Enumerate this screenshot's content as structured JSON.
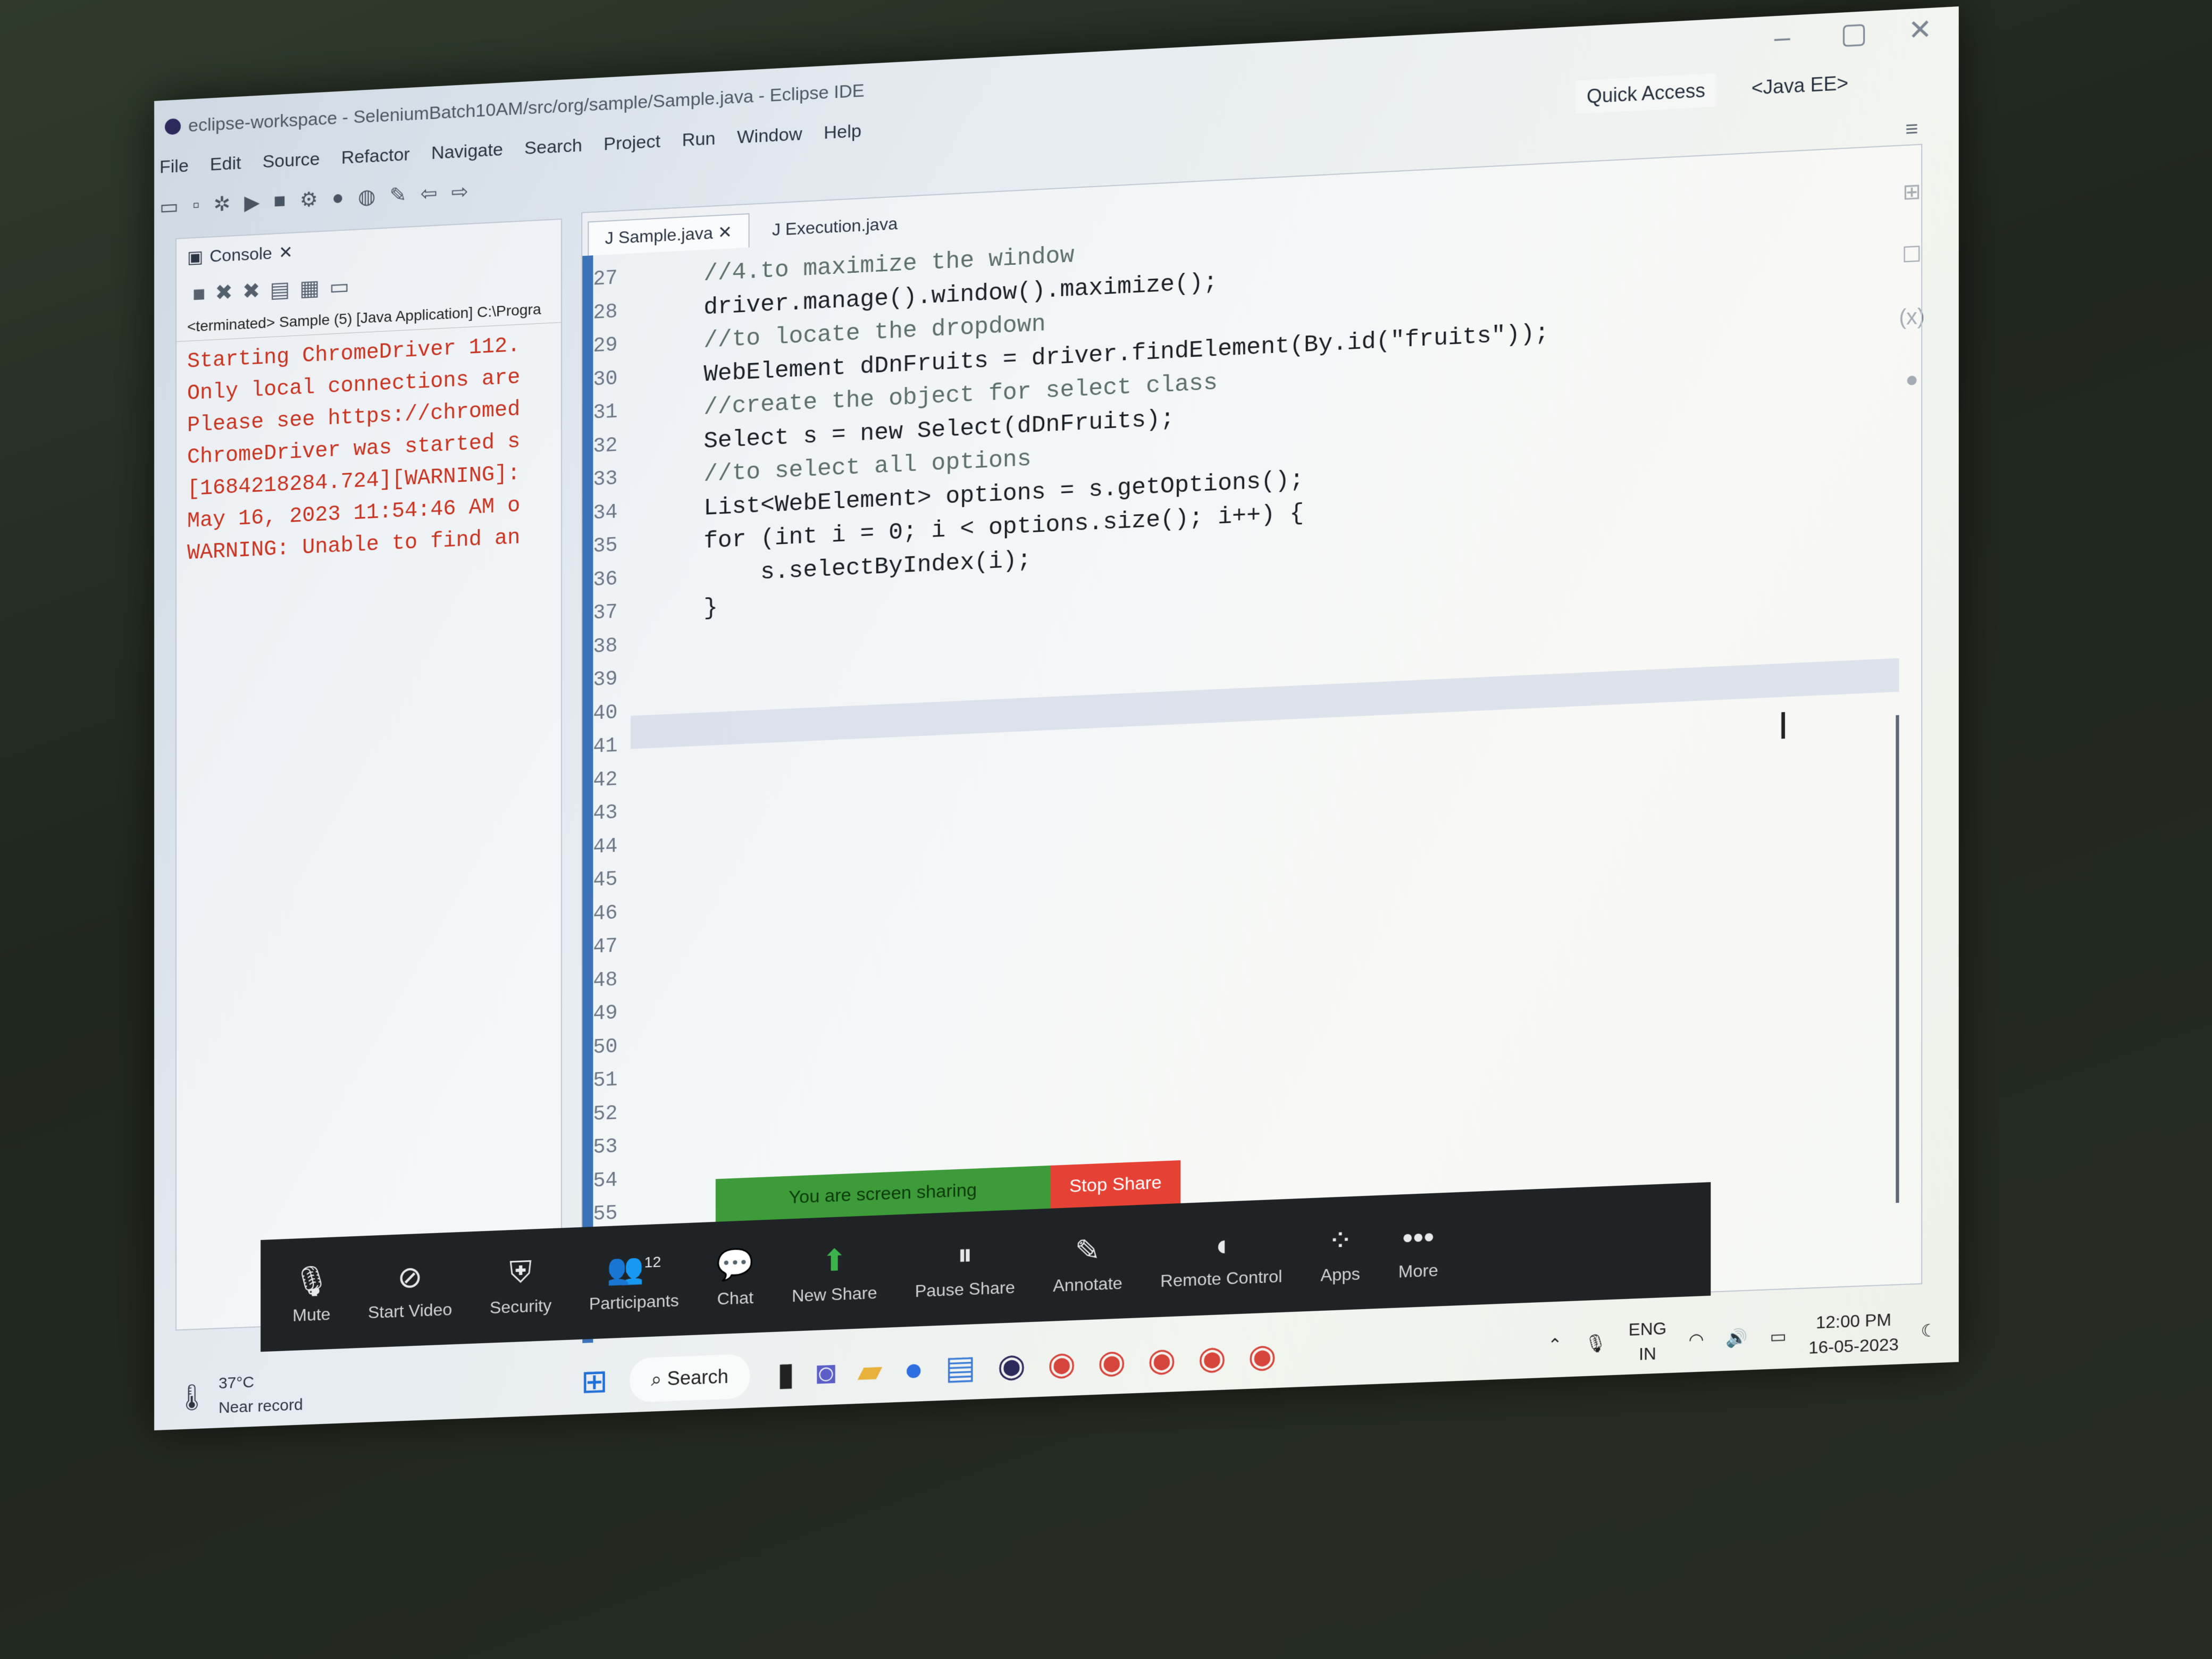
{
  "window": {
    "title": "eclipse-workspace - SeleniumBatch10AM/src/org/sample/Sample.java - Eclipse IDE",
    "controls": [
      "–",
      "▢",
      "✕"
    ]
  },
  "menu": [
    "File",
    "Edit",
    "Source",
    "Refactor",
    "Navigate",
    "Search",
    "Project",
    "Run",
    "Window",
    "Help"
  ],
  "toolbar": {
    "quick_access": "Quick Access",
    "perspective": "<Java EE>"
  },
  "console": {
    "tab_label": "Console",
    "status": "<terminated> Sample (5) [Java Application] C:\\Progra",
    "lines": [
      "Starting ChromeDriver 112.",
      "Only local connections are",
      "Please see https://chromed",
      "ChromeDriver was started s",
      "[1684218284.724][WARNING]:",
      "May 16, 2023 11:54:46 AM o",
      "WARNING: Unable to find an"
    ]
  },
  "editor": {
    "tabs": [
      {
        "label": "Sample.java",
        "active": true
      },
      {
        "label": "Execution.java",
        "active": false
      }
    ],
    "line_numbers": [
      "27",
      "28",
      "29",
      "30",
      "31",
      "32",
      "33",
      "34",
      "35",
      "36",
      "37",
      "38",
      "39",
      "40",
      "41",
      "42",
      "43",
      "44",
      "45",
      "46",
      "47",
      "48",
      "49",
      "50",
      "51",
      "52",
      "53",
      "54",
      "55"
    ],
    "code": [
      {
        "indent": "    ",
        "text": "//4.to maximize the window",
        "type": "comment"
      },
      {
        "indent": "    ",
        "text": "driver.manage().window().maximize();",
        "type": "code"
      },
      {
        "indent": "",
        "text": "",
        "type": "code"
      },
      {
        "indent": "    ",
        "text": "//to locate the dropdown",
        "type": "comment"
      },
      {
        "indent": "    ",
        "text": "WebElement dDnFruits = driver.findElement(By.id(\"fruits\"));",
        "type": "code"
      },
      {
        "indent": "",
        "text": "",
        "type": "code"
      },
      {
        "indent": "    ",
        "text": "//create the object for select class",
        "type": "comment"
      },
      {
        "indent": "    ",
        "text": "Select s = new Select(dDnFruits);",
        "type": "code"
      },
      {
        "indent": "",
        "text": "",
        "type": "code"
      },
      {
        "indent": "    ",
        "text": "//to select all options",
        "type": "comment"
      },
      {
        "indent": "    ",
        "text": "List<WebElement> options = s.getOptions();",
        "type": "code"
      },
      {
        "indent": "    ",
        "text": "for (int i = 0; i < options.size(); i++) {",
        "type": "code"
      },
      {
        "indent": "        ",
        "text": "s.selectByIndex(i);",
        "type": "code"
      },
      {
        "indent": "    ",
        "text": "}",
        "type": "code"
      }
    ]
  },
  "share_banner": {
    "status": "You are screen sharing",
    "stop": "Stop Share"
  },
  "zoom_toolbar": [
    {
      "label": "Mute",
      "icon": "microphone-icon"
    },
    {
      "label": "Start Video",
      "icon": "video-off-icon"
    },
    {
      "label": "Security",
      "icon": "shield-icon"
    },
    {
      "label": "Participants",
      "icon": "participants-icon",
      "count": "12"
    },
    {
      "label": "Chat",
      "icon": "chat-icon"
    },
    {
      "label": "New Share",
      "icon": "share-icon"
    },
    {
      "label": "Pause Share",
      "icon": "pause-icon"
    },
    {
      "label": "Annotate",
      "icon": "pencil-icon"
    },
    {
      "label": "Remote Control",
      "icon": "mouse-icon"
    },
    {
      "label": "Apps",
      "icon": "apps-icon"
    },
    {
      "label": "More",
      "icon": "more-icon"
    }
  ],
  "taskbar": {
    "weather_temp": "37°C",
    "weather_desc": "Near record",
    "search": "Search",
    "lang": "ENG",
    "region": "IN",
    "time": "12:00 PM",
    "date": "16-05-2023"
  },
  "colors": {
    "accent_blue": "#3c73b8",
    "share_green": "#3d9b3a",
    "stop_red": "#e54135"
  }
}
